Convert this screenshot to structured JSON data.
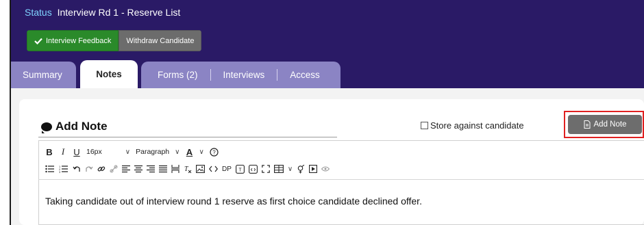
{
  "status": {
    "label": "Status",
    "value": "Interview Rd 1 - Reserve List"
  },
  "actions": {
    "feedback_label": "Interview Feedback",
    "withdraw_label": "Withdraw Candidate"
  },
  "tabs": [
    {
      "label": "Summary"
    },
    {
      "label": "Notes"
    },
    {
      "label": "Forms (2)"
    },
    {
      "label": "Interviews"
    },
    {
      "label": "Access"
    }
  ],
  "note": {
    "title": "Add Note",
    "store_label": "Store against candidate",
    "add_button_label": "Add Note"
  },
  "editor": {
    "bold": "B",
    "italic": "I",
    "underline": "U",
    "font_size": "16px",
    "block_format": "Paragraph",
    "font_color": "A",
    "dp_label": "DP",
    "content": "Taking candidate out of interview round 1 reserve as first choice candidate declined offer."
  },
  "colors": {
    "header": "#2a1a66",
    "tab": "#8b84c4",
    "feedback": "#2a8a2a",
    "highlight": "#e02020"
  }
}
